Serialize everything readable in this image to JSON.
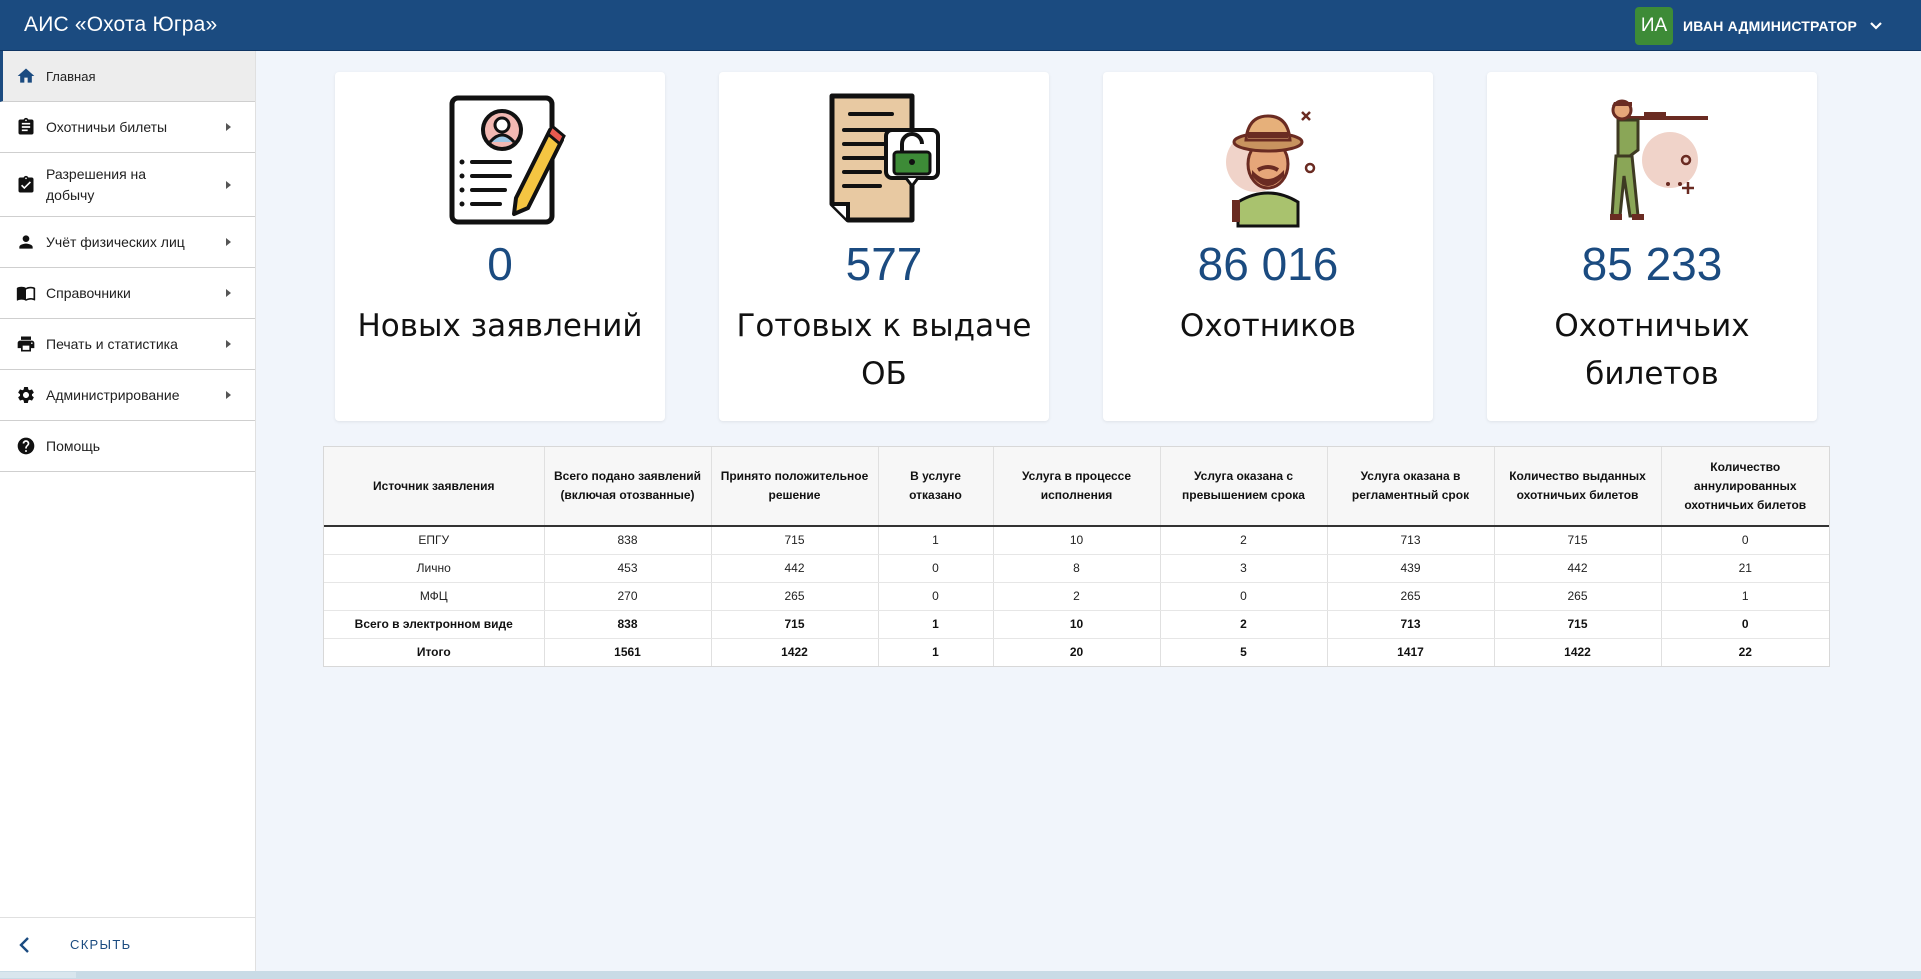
{
  "header": {
    "title": "АИС «Охота Югра»",
    "avatar_initials": "ИА",
    "user_name": "ИВАН АДМИНИСТРАТОР",
    "colors": {
      "bar": "#1b4b80",
      "avatar": "#3d8b37"
    }
  },
  "sidebar": {
    "items": [
      {
        "label": "Главная",
        "icon": "home-icon"
      },
      {
        "label": "Охотничьи билеты",
        "icon": "clipboard-icon"
      },
      {
        "label": "Разрешения на добычу",
        "icon": "clipboard-check-icon"
      },
      {
        "label": "Учёт физических лиц",
        "icon": "person-icon"
      },
      {
        "label": "Справочники",
        "icon": "book-icon"
      },
      {
        "label": "Печать и статистика",
        "icon": "printer-icon"
      },
      {
        "label": "Администрирование",
        "icon": "gear-icon"
      },
      {
        "label": "Помощь",
        "icon": "help-icon"
      }
    ],
    "hide_label": "СКРЫТЬ"
  },
  "cards": [
    {
      "value": "0",
      "label": "Новых заявлений",
      "illustration": "application-form-icon"
    },
    {
      "value": "577",
      "label": "Готовых к выдаче ОБ",
      "illustration": "document-unlocked-icon"
    },
    {
      "value": "86 016",
      "label": "Охотников",
      "illustration": "hunter-icon"
    },
    {
      "value": "85 233",
      "label": "Охотничьих билетов",
      "illustration": "rifleman-icon"
    }
  ],
  "table": {
    "headers": [
      "Источник заявления",
      "Всего подано заявлений (включая отозванные)",
      "Принято положительное решение",
      "В услуге отказано",
      "Услуга в процессе исполнения",
      "Услуга оказана с превышением срока",
      "Услуга оказана в регламентный срок",
      "Количество выданных охотничьих билетов",
      "Количество аннулированных охотничьих билетов"
    ],
    "rows": [
      [
        "ЕПГУ",
        "838",
        "715",
        "1",
        "10",
        "2",
        "713",
        "715",
        "0"
      ],
      [
        "Лично",
        "453",
        "442",
        "0",
        "8",
        "3",
        "439",
        "442",
        "21"
      ],
      [
        "МФЦ",
        "270",
        "265",
        "0",
        "2",
        "0",
        "265",
        "265",
        "1"
      ],
      [
        "Всего в электронном виде",
        "838",
        "715",
        "1",
        "10",
        "2",
        "713",
        "715",
        "0"
      ],
      [
        "Итого",
        "1561",
        "1422",
        "1",
        "20",
        "5",
        "1417",
        "1422",
        "22"
      ]
    ],
    "bold_rows": [
      3,
      4
    ]
  }
}
